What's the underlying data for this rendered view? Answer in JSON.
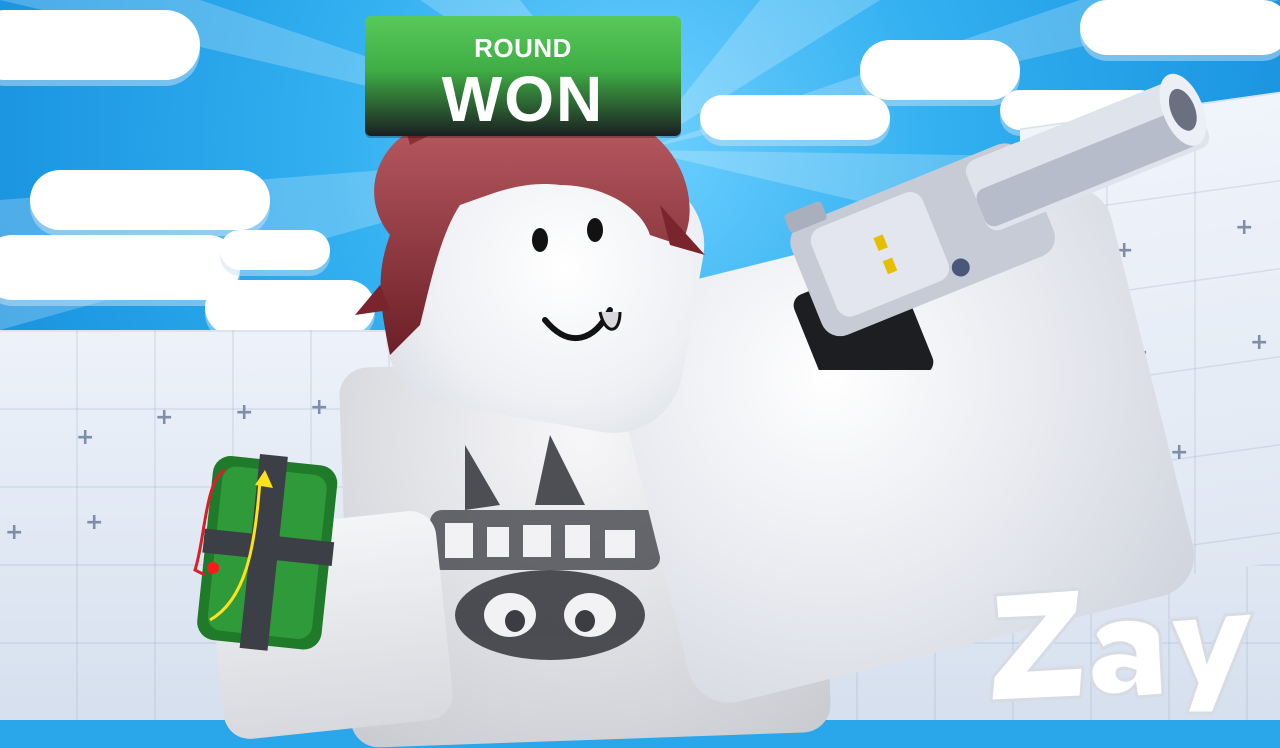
{
  "badge": {
    "line1": "ROUND",
    "line2": "WON"
  },
  "signature": "Zay",
  "colors": {
    "sky": "#2aa6ea",
    "badge_green": "#3fae44",
    "hair": "#8c2f37",
    "bomb_green": "#1f7a2a"
  },
  "icons": [
    "revolver-icon",
    "bomb-icon"
  ]
}
